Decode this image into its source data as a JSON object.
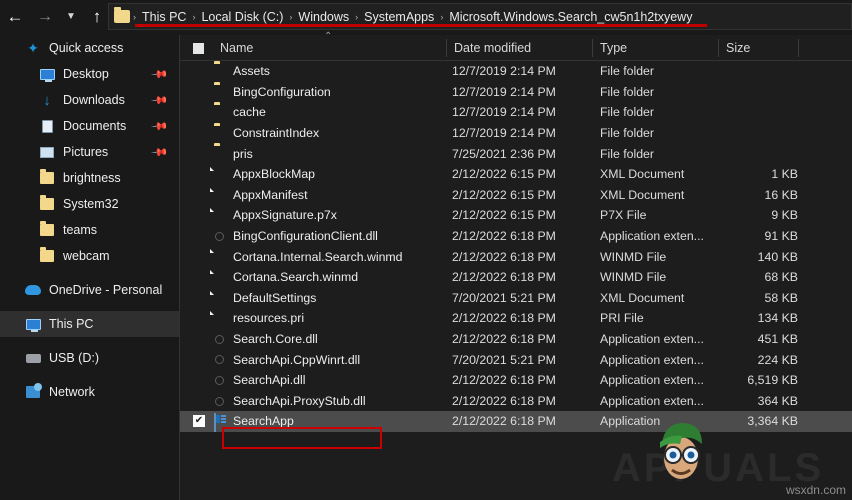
{
  "nav": {
    "back_icon": "arrow-left-icon",
    "forward_icon": "arrow-right-icon",
    "recent_icon": "chevron-down-icon",
    "up_icon": "arrow-up-icon",
    "separator": "›"
  },
  "breadcrumb": {
    "folder_icon": "folder-icon",
    "items": [
      "This PC",
      "Local Disk (C:)",
      "Windows",
      "SystemApps",
      "Microsoft.Windows.Search_cw5n1h2txyewy"
    ]
  },
  "sidebar": {
    "items": [
      {
        "label": "Quick access",
        "icon": "star-icon",
        "indent": 0,
        "pinned": false,
        "selected": false
      },
      {
        "label": "Desktop",
        "icon": "monitor-icon",
        "indent": 1,
        "pinned": true,
        "selected": false
      },
      {
        "label": "Downloads",
        "icon": "download-icon",
        "indent": 1,
        "pinned": true,
        "selected": false
      },
      {
        "label": "Documents",
        "icon": "document-icon",
        "indent": 1,
        "pinned": true,
        "selected": false
      },
      {
        "label": "Pictures",
        "icon": "picture-icon",
        "indent": 1,
        "pinned": true,
        "selected": false
      },
      {
        "label": "brightness",
        "icon": "folder-icon",
        "indent": 1,
        "pinned": false,
        "selected": false
      },
      {
        "label": "System32",
        "icon": "folder-icon",
        "indent": 1,
        "pinned": false,
        "selected": false
      },
      {
        "label": "teams",
        "icon": "folder-icon",
        "indent": 1,
        "pinned": false,
        "selected": false
      },
      {
        "label": "webcam",
        "icon": "folder-icon",
        "indent": 1,
        "pinned": false,
        "selected": false
      },
      {
        "label": "OneDrive - Personal",
        "icon": "cloud-icon",
        "indent": 0,
        "pinned": false,
        "selected": false
      },
      {
        "label": "This PC",
        "icon": "monitor-icon",
        "indent": 0,
        "pinned": false,
        "selected": true
      },
      {
        "label": "USB (D:)",
        "icon": "usb-drive-icon",
        "indent": 0,
        "pinned": false,
        "selected": false
      },
      {
        "label": "Network",
        "icon": "network-icon",
        "indent": 0,
        "pinned": false,
        "selected": false
      }
    ],
    "pin_glyph": "📌"
  },
  "file_list": {
    "columns": [
      "Name",
      "Date modified",
      "Type",
      "Size"
    ],
    "sort_indicator": "⌃",
    "select_all_checkbox": "unchecked",
    "rows": [
      {
        "name": "Assets",
        "date": "12/7/2019 2:14 PM",
        "type": "File folder",
        "size": "",
        "icon": "folder-icon",
        "selected": false
      },
      {
        "name": "BingConfiguration",
        "date": "12/7/2019 2:14 PM",
        "type": "File folder",
        "size": "",
        "icon": "folder-icon",
        "selected": false
      },
      {
        "name": "cache",
        "date": "12/7/2019 2:14 PM",
        "type": "File folder",
        "size": "",
        "icon": "folder-icon",
        "selected": false
      },
      {
        "name": "ConstraintIndex",
        "date": "12/7/2019 2:14 PM",
        "type": "File folder",
        "size": "",
        "icon": "folder-icon",
        "selected": false
      },
      {
        "name": "pris",
        "date": "7/25/2021 2:36 PM",
        "type": "File folder",
        "size": "",
        "icon": "folder-icon",
        "selected": false
      },
      {
        "name": "AppxBlockMap",
        "date": "2/12/2022 6:15 PM",
        "type": "XML Document",
        "size": "1 KB",
        "icon": "xml-file-icon",
        "selected": false
      },
      {
        "name": "AppxManifest",
        "date": "2/12/2022 6:15 PM",
        "type": "XML Document",
        "size": "16 KB",
        "icon": "xml-file-icon",
        "selected": false
      },
      {
        "name": "AppxSignature.p7x",
        "date": "2/12/2022 6:15 PM",
        "type": "P7X File",
        "size": "9 KB",
        "icon": "generic-file-icon",
        "selected": false
      },
      {
        "name": "BingConfigurationClient.dll",
        "date": "2/12/2022 6:18 PM",
        "type": "Application exten...",
        "size": "91 KB",
        "icon": "dll-file-icon",
        "selected": false
      },
      {
        "name": "Cortana.Internal.Search.winmd",
        "date": "2/12/2022 6:18 PM",
        "type": "WINMD File",
        "size": "140 KB",
        "icon": "generic-file-icon",
        "selected": false
      },
      {
        "name": "Cortana.Search.winmd",
        "date": "2/12/2022 6:18 PM",
        "type": "WINMD File",
        "size": "68 KB",
        "icon": "generic-file-icon",
        "selected": false
      },
      {
        "name": "DefaultSettings",
        "date": "7/20/2021 5:21 PM",
        "type": "XML Document",
        "size": "58 KB",
        "icon": "xml-file-icon",
        "selected": false
      },
      {
        "name": "resources.pri",
        "date": "2/12/2022 6:18 PM",
        "type": "PRI File",
        "size": "134 KB",
        "icon": "generic-file-icon",
        "selected": false
      },
      {
        "name": "Search.Core.dll",
        "date": "2/12/2022 6:18 PM",
        "type": "Application exten...",
        "size": "451 KB",
        "icon": "dll-file-icon",
        "selected": false
      },
      {
        "name": "SearchApi.CppWinrt.dll",
        "date": "7/20/2021 5:21 PM",
        "type": "Application exten...",
        "size": "224 KB",
        "icon": "dll-file-icon",
        "selected": false
      },
      {
        "name": "SearchApi.dll",
        "date": "2/12/2022 6:18 PM",
        "type": "Application exten...",
        "size": "6,519 KB",
        "icon": "dll-file-icon",
        "selected": false
      },
      {
        "name": "SearchApi.ProxyStub.dll",
        "date": "2/12/2022 6:18 PM",
        "type": "Application exten...",
        "size": "364 KB",
        "icon": "dll-file-icon",
        "selected": false
      },
      {
        "name": "SearchApp",
        "date": "2/12/2022 6:18 PM",
        "type": "Application",
        "size": "3,364 KB",
        "icon": "application-icon",
        "selected": true
      }
    ],
    "checked_glyph": "✔"
  },
  "annotation": {
    "highlight_color": "#cc0000"
  },
  "watermark": {
    "brand": "APPUALS",
    "site": "wsxdn.com"
  }
}
